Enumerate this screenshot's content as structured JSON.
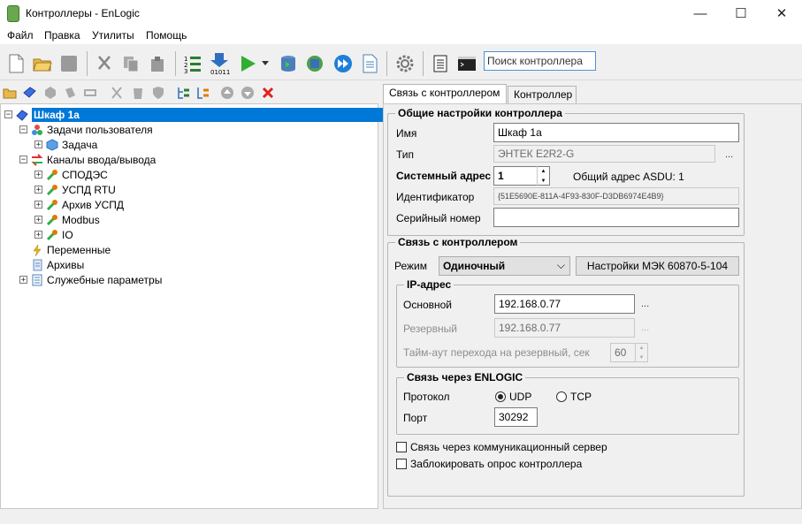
{
  "window": {
    "title": "Контроллеры - EnLogic",
    "minimize": "—",
    "maximize": "☐",
    "close": "✕"
  },
  "menu": {
    "file": "Файл",
    "edit": "Правка",
    "utils": "Утилиты",
    "help": "Помощь"
  },
  "toolbar": {
    "search_placeholder": "Поиск контроллера"
  },
  "tree": {
    "root": "Шкаф 1а",
    "user_tasks": "Задачи пользователя",
    "task": "Задача",
    "io_channels": "Каналы ввода/вывода",
    "ch1": "СПОДЭС",
    "ch2": "УСПД RTU",
    "ch3": "Архив УСПД",
    "ch4": "Modbus",
    "ch5": "IO",
    "variables": "Переменные",
    "archives": "Архивы",
    "service": "Служебные параметры"
  },
  "tabs": {
    "connection": "Связь с контроллером",
    "controller": "Контроллер"
  },
  "general": {
    "group_title": "Общие настройки контроллера",
    "name_label": "Имя",
    "name_value": "Шкаф 1а",
    "type_label": "Тип",
    "type_value": "ЭНТЕК E2R2-G",
    "sysaddr_label": "Системный адрес",
    "sysaddr_value": "1",
    "asdu": "Общий адрес ASDU: 1",
    "id_label": "Идентификатор",
    "id_value": "{51E5690E-811A-4F93-830F-D3DB6974E4B9}",
    "serial_label": "Серийный номер",
    "serial_value": ""
  },
  "conn": {
    "group_title": "Связь с контроллером",
    "mode_label": "Режим",
    "mode_value": "Одиночный",
    "iec_button": "Настройки МЭК 60870-5-104",
    "ip_group": "IP-адрес",
    "primary_label": "Основной",
    "primary_value": "192.168.0.77",
    "reserve_label": "Резервный",
    "reserve_value": "192.168.0.77",
    "timeout_label": "Тайм-аут перехода на резервный, сек",
    "timeout_value": "60",
    "enlogic_group": "Связь через ENLOGIC",
    "protocol_label": "Протокол",
    "udp": "UDP",
    "tcp": "TCP",
    "port_label": "Порт",
    "port_value": "30292",
    "comm_server": "Связь через коммуникационный сервер",
    "block_poll": "Заблокировать опрос контроллера"
  },
  "colors": {
    "selection": "#0078d7",
    "accent_border": "#4a90d9"
  }
}
